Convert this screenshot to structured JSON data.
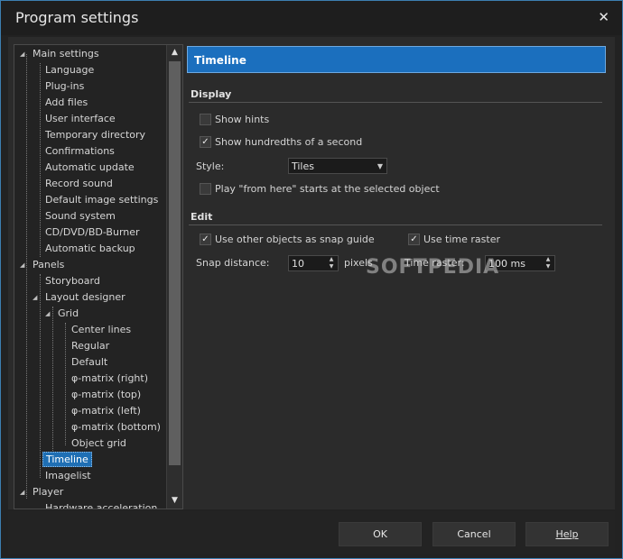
{
  "window": {
    "title": "Program settings"
  },
  "tree": {
    "items": [
      {
        "label": "Main settings"
      },
      {
        "label": "Language"
      },
      {
        "label": "Plug-ins"
      },
      {
        "label": "Add files"
      },
      {
        "label": "User interface"
      },
      {
        "label": "Temporary directory"
      },
      {
        "label": "Confirmations"
      },
      {
        "label": "Automatic update"
      },
      {
        "label": "Record sound"
      },
      {
        "label": "Default image settings"
      },
      {
        "label": "Sound system"
      },
      {
        "label": "CD/DVD/BD-Burner"
      },
      {
        "label": "Automatic backup"
      },
      {
        "label": "Panels"
      },
      {
        "label": "Storyboard"
      },
      {
        "label": "Layout designer"
      },
      {
        "label": "Grid"
      },
      {
        "label": "Center lines"
      },
      {
        "label": "Regular"
      },
      {
        "label": "Default"
      },
      {
        "label": "φ-matrix (right)"
      },
      {
        "label": "φ-matrix (top)"
      },
      {
        "label": "φ-matrix (left)"
      },
      {
        "label": "φ-matrix (bottom)"
      },
      {
        "label": "Object grid"
      },
      {
        "label": "Timeline"
      },
      {
        "label": "Imagelist"
      },
      {
        "label": "Player"
      },
      {
        "label": "Hardware acceleration"
      }
    ],
    "selected": "Timeline"
  },
  "panel": {
    "header": "Timeline",
    "display": {
      "section": "Display",
      "show_hints": "Show hints",
      "show_hundredths": "Show hundredths of a second",
      "style_label": "Style:",
      "style_value": "Tiles",
      "play_from_here": "Play \"from here\" starts at the selected object"
    },
    "edit": {
      "section": "Edit",
      "use_snap": "Use other objects as snap guide",
      "use_raster": "Use time raster",
      "snap_label": "Snap distance:",
      "snap_value": "10",
      "snap_unit": "pixels",
      "raster_label": "Time raster:",
      "raster_value": "100 ms"
    }
  },
  "watermark": "SOFTPEDIA",
  "buttons": {
    "ok": "OK",
    "cancel": "Cancel",
    "help": "Help"
  }
}
